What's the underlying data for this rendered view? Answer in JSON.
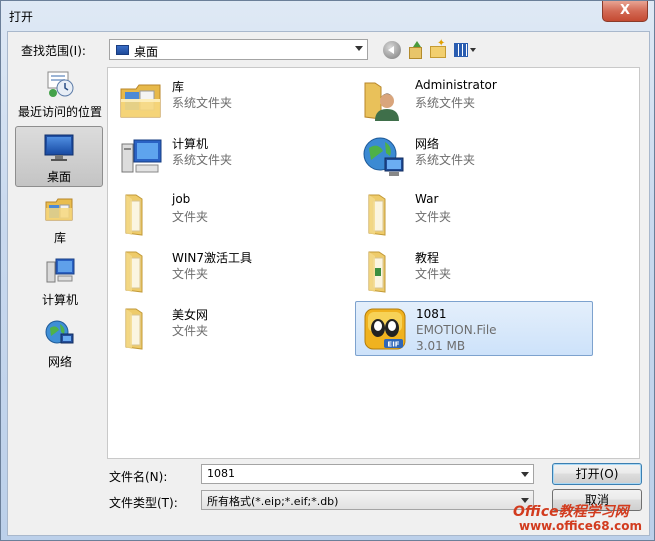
{
  "window": {
    "title": "打开",
    "close_label": "X"
  },
  "toolbar": {
    "lookin_label": "查找范围(I):",
    "lookin_value": "桌面",
    "icons": [
      "back-icon",
      "up-folder-icon",
      "new-folder-icon",
      "views-menu-icon"
    ]
  },
  "sidebar": {
    "items": [
      {
        "label": "最近访问的位置",
        "icon": "recent-places-icon"
      },
      {
        "label": "桌面",
        "icon": "desktop-icon",
        "selected": true
      },
      {
        "label": "库",
        "icon": "libraries-icon"
      },
      {
        "label": "计算机",
        "icon": "computer-icon"
      },
      {
        "label": "网络",
        "icon": "network-icon"
      }
    ]
  },
  "files": [
    {
      "name": "库",
      "type": "系统文件夹",
      "icon": "libraries-icon"
    },
    {
      "name": "Administrator",
      "type": "系统文件夹",
      "icon": "user-folder-icon"
    },
    {
      "name": "计算机",
      "type": "系统文件夹",
      "icon": "computer-icon"
    },
    {
      "name": "网络",
      "type": "系统文件夹",
      "icon": "network-icon"
    },
    {
      "name": "job",
      "type": "文件夹",
      "icon": "folder-icon"
    },
    {
      "name": "War",
      "type": "文件夹",
      "icon": "folder-icon"
    },
    {
      "name": "WIN7激活工具",
      "type": "文件夹",
      "icon": "folder-icon"
    },
    {
      "name": "教程",
      "type": "文件夹",
      "icon": "folder-icon"
    },
    {
      "name": "美女网",
      "type": "文件夹",
      "icon": "folder-icon"
    },
    {
      "name": "1081",
      "type": "EMOTION.File",
      "size": "3.01 MB",
      "icon": "qq-emotion-file-icon",
      "selected": true
    }
  ],
  "footer": {
    "filename_label": "文件名(N):",
    "filename_value": "1081",
    "filetype_label": "文件类型(T):",
    "filetype_value": "所有格式(*.eip;*.eif;*.db)",
    "open_button": "打开(O)",
    "cancel_button": "取消"
  },
  "watermark": {
    "line1": "Office教程学习网",
    "line2": "www.office68.com"
  }
}
